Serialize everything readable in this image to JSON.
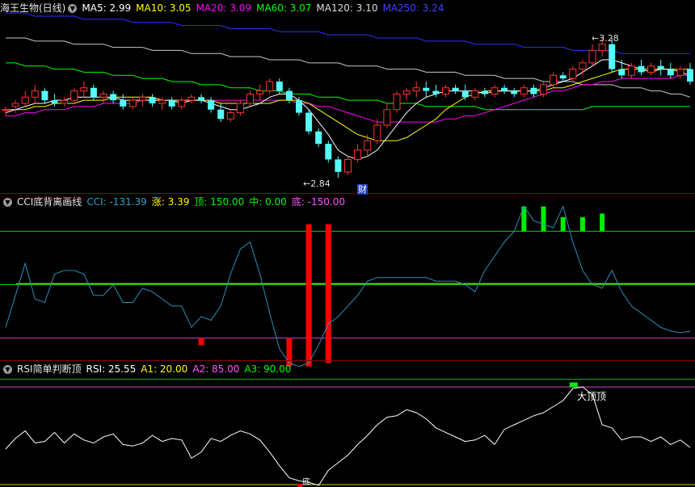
{
  "price_panel": {
    "title": "海王生物(日线)",
    "ma": [
      {
        "label": "MA5: 2.99",
        "color": "#ffffff"
      },
      {
        "label": "MA10: 3.05",
        "color": "#ffff00"
      },
      {
        "label": "MA20: 3.09",
        "color": "#ff00ff"
      },
      {
        "label": "MA60: 3.07",
        "color": "#00ff00"
      },
      {
        "label": "MA120: 3.10",
        "color": "#dddddd"
      },
      {
        "label": "MA250: 3.24",
        "color": "#4040ff"
      }
    ],
    "high_label": "3.28",
    "low_label": "2.84",
    "finance_mark": "财"
  },
  "cci_panel": {
    "title": "CCI底背离画线",
    "values": [
      {
        "label": "CCI: -131.39",
        "color": "#3aa0c8"
      },
      {
        "label": "涨: 3.39",
        "color": "#ffff00"
      },
      {
        "label": "顶: 150.00",
        "color": "#00ff00"
      },
      {
        "label": "中: 0.00",
        "color": "#00ff00"
      },
      {
        "label": "底: -150.00",
        "color": "#ff55ff"
      }
    ]
  },
  "rsi_panel": {
    "title": "RSI简单判断顶",
    "values": [
      {
        "label": "RSI: 25.55",
        "color": "#ffffff"
      },
      {
        "label": "A1: 20.00",
        "color": "#ffff00"
      },
      {
        "label": "A2: 85.00",
        "color": "#ff55ff"
      },
      {
        "label": "A3: 90.00",
        "color": "#00ff00"
      }
    ],
    "top_label": "大顶",
    "top_label2": "顶",
    "bottom_label": "底"
  },
  "colors": {
    "up": "#ff3232",
    "down": "#54fcfc",
    "separator": "#8b0000"
  },
  "chart_data": [
    {
      "type": "candlestick",
      "title": "海王生物(日线)",
      "ylim": [
        2.8,
        3.36
      ],
      "candles": [
        [
          3.06,
          3.07,
          3.04,
          3.06
        ],
        [
          3.07,
          3.09,
          3.05,
          3.08
        ],
        [
          3.08,
          3.12,
          3.07,
          3.1
        ],
        [
          3.1,
          3.14,
          3.08,
          3.12
        ],
        [
          3.12,
          3.13,
          3.08,
          3.09
        ],
        [
          3.09,
          3.11,
          3.07,
          3.08
        ],
        [
          3.08,
          3.1,
          3.07,
          3.09
        ],
        [
          3.09,
          3.13,
          3.08,
          3.12
        ],
        [
          3.12,
          3.15,
          3.1,
          3.13
        ],
        [
          3.13,
          3.14,
          3.09,
          3.1
        ],
        [
          3.1,
          3.12,
          3.08,
          3.11
        ],
        [
          3.11,
          3.12,
          3.08,
          3.09
        ],
        [
          3.09,
          3.11,
          3.06,
          3.07
        ],
        [
          3.07,
          3.1,
          3.06,
          3.09
        ],
        [
          3.09,
          3.11,
          3.07,
          3.1
        ],
        [
          3.1,
          3.11,
          3.07,
          3.08
        ],
        [
          3.08,
          3.1,
          3.06,
          3.09
        ],
        [
          3.09,
          3.1,
          3.06,
          3.07
        ],
        [
          3.07,
          3.1,
          3.06,
          3.09
        ],
        [
          3.09,
          3.11,
          3.08,
          3.1
        ],
        [
          3.1,
          3.11,
          3.08,
          3.09
        ],
        [
          3.09,
          3.1,
          3.05,
          3.06
        ],
        [
          3.06,
          3.08,
          3.02,
          3.03
        ],
        [
          3.03,
          3.06,
          3.02,
          3.05
        ],
        [
          3.05,
          3.09,
          3.04,
          3.08
        ],
        [
          3.08,
          3.12,
          3.07,
          3.11
        ],
        [
          3.11,
          3.14,
          3.09,
          3.12
        ],
        [
          3.12,
          3.16,
          3.11,
          3.15
        ],
        [
          3.15,
          3.16,
          3.11,
          3.12
        ],
        [
          3.12,
          3.13,
          3.08,
          3.09
        ],
        [
          3.09,
          3.1,
          3.04,
          3.05
        ],
        [
          3.05,
          3.06,
          2.98,
          2.99
        ],
        [
          2.99,
          3.0,
          2.94,
          2.95
        ],
        [
          2.95,
          2.96,
          2.89,
          2.9
        ],
        [
          2.9,
          2.91,
          2.84,
          2.86
        ],
        [
          2.86,
          2.91,
          2.85,
          2.9
        ],
        [
          2.9,
          2.95,
          2.89,
          2.93
        ],
        [
          2.93,
          2.98,
          2.91,
          2.96
        ],
        [
          2.96,
          3.03,
          2.95,
          3.01
        ],
        [
          3.01,
          3.08,
          3.0,
          3.06
        ],
        [
          3.06,
          3.12,
          3.05,
          3.11
        ],
        [
          3.11,
          3.13,
          3.09,
          3.12
        ],
        [
          3.12,
          3.15,
          3.1,
          3.13
        ],
        [
          3.13,
          3.15,
          3.1,
          3.12
        ],
        [
          3.12,
          3.14,
          3.1,
          3.11
        ],
        [
          3.11,
          3.14,
          3.1,
          3.13
        ],
        [
          3.13,
          3.14,
          3.11,
          3.12
        ],
        [
          3.12,
          3.14,
          3.09,
          3.1
        ],
        [
          3.1,
          3.13,
          3.09,
          3.12
        ],
        [
          3.12,
          3.13,
          3.1,
          3.11
        ],
        [
          3.11,
          3.14,
          3.1,
          3.13
        ],
        [
          3.13,
          3.14,
          3.11,
          3.12
        ],
        [
          3.12,
          3.13,
          3.1,
          3.11
        ],
        [
          3.11,
          3.14,
          3.1,
          3.13
        ],
        [
          3.13,
          3.14,
          3.1,
          3.11
        ],
        [
          3.11,
          3.15,
          3.1,
          3.14
        ],
        [
          3.14,
          3.18,
          3.13,
          3.17
        ],
        [
          3.17,
          3.18,
          3.15,
          3.16
        ],
        [
          3.16,
          3.2,
          3.15,
          3.19
        ],
        [
          3.19,
          3.22,
          3.17,
          3.21
        ],
        [
          3.21,
          3.27,
          3.2,
          3.25
        ],
        [
          3.25,
          3.29,
          3.23,
          3.27
        ],
        [
          3.27,
          3.29,
          3.18,
          3.19
        ],
        [
          3.19,
          3.22,
          3.16,
          3.17
        ],
        [
          3.17,
          3.21,
          3.16,
          3.2
        ],
        [
          3.2,
          3.22,
          3.17,
          3.18
        ],
        [
          3.18,
          3.21,
          3.17,
          3.2
        ],
        [
          3.2,
          3.22,
          3.17,
          3.19
        ],
        [
          3.19,
          3.21,
          3.16,
          3.17
        ],
        [
          3.17,
          3.2,
          3.16,
          3.19
        ],
        [
          3.19,
          3.21,
          3.14,
          3.15
        ]
      ],
      "ma_series": {
        "MA5": [
          3.05,
          3.06,
          3.07,
          3.08,
          3.08,
          3.09,
          3.09,
          3.1,
          3.1,
          3.1,
          3.1,
          3.1,
          3.09,
          3.09,
          3.09,
          3.09,
          3.09,
          3.09,
          3.08,
          3.09,
          3.09,
          3.08,
          3.07,
          3.06,
          3.06,
          3.07,
          3.08,
          3.1,
          3.11,
          3.11,
          3.09,
          3.06,
          3.02,
          2.98,
          2.93,
          2.91,
          2.9,
          2.91,
          2.93,
          2.97,
          3.01,
          3.05,
          3.08,
          3.1,
          3.11,
          3.12,
          3.12,
          3.12,
          3.12,
          3.11,
          3.12,
          3.12,
          3.12,
          3.12,
          3.12,
          3.13,
          3.14,
          3.15,
          3.16,
          3.18,
          3.2,
          3.22,
          3.22,
          3.21,
          3.2,
          3.19,
          3.18,
          3.19,
          3.19,
          3.18,
          3.17
        ],
        "MA10": [
          3.06,
          3.06,
          3.06,
          3.07,
          3.07,
          3.08,
          3.08,
          3.08,
          3.09,
          3.09,
          3.09,
          3.1,
          3.1,
          3.1,
          3.1,
          3.1,
          3.09,
          3.09,
          3.09,
          3.09,
          3.09,
          3.09,
          3.08,
          3.08,
          3.08,
          3.08,
          3.08,
          3.08,
          3.09,
          3.09,
          3.09,
          3.08,
          3.06,
          3.04,
          3.02,
          3.0,
          2.98,
          2.97,
          2.96,
          2.96,
          2.96,
          2.97,
          2.99,
          3.01,
          3.03,
          3.06,
          3.08,
          3.1,
          3.11,
          3.12,
          3.12,
          3.12,
          3.12,
          3.12,
          3.12,
          3.12,
          3.13,
          3.13,
          3.14,
          3.15,
          3.16,
          3.17,
          3.18,
          3.19,
          3.19,
          3.19,
          3.19,
          3.19,
          3.19,
          3.19,
          3.19
        ],
        "MA20": [
          3.04,
          3.04,
          3.05,
          3.05,
          3.06,
          3.06,
          3.06,
          3.07,
          3.07,
          3.07,
          3.08,
          3.08,
          3.08,
          3.08,
          3.09,
          3.09,
          3.09,
          3.09,
          3.09,
          3.09,
          3.09,
          3.09,
          3.09,
          3.09,
          3.09,
          3.09,
          3.09,
          3.09,
          3.09,
          3.09,
          3.08,
          3.08,
          3.07,
          3.07,
          3.06,
          3.05,
          3.04,
          3.03,
          3.02,
          3.02,
          3.02,
          3.02,
          3.02,
          3.02,
          3.02,
          3.03,
          3.03,
          3.04,
          3.04,
          3.05,
          3.06,
          3.07,
          3.08,
          3.09,
          3.1,
          3.11,
          3.12,
          3.12,
          3.13,
          3.14,
          3.14,
          3.15,
          3.15,
          3.16,
          3.16,
          3.16,
          3.16,
          3.16,
          3.16,
          3.17,
          3.17
        ],
        "MA60": [
          3.21,
          3.21,
          3.2,
          3.2,
          3.2,
          3.19,
          3.19,
          3.19,
          3.18,
          3.18,
          3.18,
          3.17,
          3.17,
          3.17,
          3.16,
          3.16,
          3.16,
          3.15,
          3.15,
          3.15,
          3.14,
          3.14,
          3.14,
          3.13,
          3.13,
          3.13,
          3.12,
          3.12,
          3.12,
          3.11,
          3.11,
          3.11,
          3.1,
          3.1,
          3.1,
          3.09,
          3.09,
          3.09,
          3.09,
          3.08,
          3.08,
          3.08,
          3.08,
          3.07,
          3.07,
          3.07,
          3.07,
          3.07,
          3.07,
          3.06,
          3.06,
          3.06,
          3.06,
          3.06,
          3.06,
          3.06,
          3.06,
          3.06,
          3.06,
          3.06,
          3.07,
          3.07,
          3.07,
          3.07,
          3.07,
          3.07,
          3.07,
          3.07,
          3.07,
          3.07,
          3.07
        ],
        "MA120": [
          3.29,
          3.29,
          3.29,
          3.28,
          3.28,
          3.28,
          3.28,
          3.27,
          3.27,
          3.27,
          3.27,
          3.26,
          3.26,
          3.26,
          3.26,
          3.25,
          3.25,
          3.25,
          3.25,
          3.24,
          3.24,
          3.24,
          3.24,
          3.23,
          3.23,
          3.23,
          3.23,
          3.22,
          3.22,
          3.22,
          3.22,
          3.21,
          3.21,
          3.21,
          3.21,
          3.2,
          3.2,
          3.2,
          3.2,
          3.19,
          3.19,
          3.19,
          3.19,
          3.18,
          3.18,
          3.18,
          3.18,
          3.17,
          3.17,
          3.17,
          3.17,
          3.16,
          3.16,
          3.16,
          3.16,
          3.15,
          3.15,
          3.15,
          3.15,
          3.14,
          3.14,
          3.14,
          3.14,
          3.13,
          3.13,
          3.13,
          3.12,
          3.12,
          3.11,
          3.11,
          3.1
        ],
        "MA250": [
          3.37,
          3.37,
          3.37,
          3.36,
          3.36,
          3.36,
          3.36,
          3.36,
          3.35,
          3.35,
          3.35,
          3.35,
          3.35,
          3.34,
          3.34,
          3.34,
          3.34,
          3.34,
          3.33,
          3.33,
          3.33,
          3.33,
          3.33,
          3.32,
          3.32,
          3.32,
          3.32,
          3.32,
          3.31,
          3.31,
          3.31,
          3.31,
          3.31,
          3.3,
          3.3,
          3.3,
          3.3,
          3.3,
          3.29,
          3.29,
          3.29,
          3.29,
          3.29,
          3.28,
          3.28,
          3.28,
          3.28,
          3.28,
          3.27,
          3.27,
          3.27,
          3.27,
          3.27,
          3.26,
          3.26,
          3.26,
          3.26,
          3.26,
          3.25,
          3.25,
          3.25,
          3.25,
          3.25,
          3.24,
          3.24,
          3.24,
          3.24,
          3.24,
          3.24,
          3.24,
          3.24
        ]
      }
    },
    {
      "type": "line",
      "title": "CCI底背离画线",
      "ylim": [
        -210,
        210
      ],
      "levels": {
        "top": 150,
        "middle": 0,
        "bottom": -150
      },
      "cci": [
        -120,
        -30,
        60,
        -40,
        -50,
        30,
        40,
        40,
        30,
        -30,
        -30,
        0,
        -50,
        -50,
        -10,
        -20,
        -40,
        -60,
        -60,
        -120,
        -90,
        -100,
        -60,
        30,
        100,
        120,
        30,
        -80,
        -180,
        -220,
        -230,
        -220,
        -170,
        -110,
        -90,
        -60,
        -30,
        10,
        20,
        20,
        20,
        20,
        20,
        20,
        10,
        10,
        10,
        0,
        -20,
        40,
        80,
        120,
        150,
        220,
        180,
        170,
        160,
        220,
        120,
        40,
        0,
        -10,
        40,
        -20,
        -60,
        -80,
        -100,
        -120,
        -130,
        -135,
        -131
      ],
      "red_bars": [
        [
          20,
          -150,
          -170
        ],
        [
          29,
          -150,
          -230
        ],
        [
          31,
          -230,
          170
        ],
        [
          33,
          -220,
          170
        ]
      ],
      "green_bars": [
        [
          53,
          150,
          220
        ],
        [
          55,
          150,
          220
        ],
        [
          57,
          150,
          190
        ],
        [
          59,
          150,
          190
        ],
        [
          61,
          150,
          200
        ]
      ]
    },
    {
      "type": "line",
      "title": "RSI简单判断顶",
      "ylim": [
        20,
        92
      ],
      "levels": {
        "A1": 20,
        "A2": 85,
        "A3": 90
      },
      "rsi": [
        44,
        51,
        56,
        48,
        49,
        55,
        48,
        54,
        50,
        48,
        52,
        54,
        47,
        46,
        48,
        53,
        49,
        51,
        50,
        38,
        42,
        51,
        49,
        53,
        56,
        54,
        50,
        42,
        33,
        25,
        23,
        22,
        20,
        30,
        35,
        40,
        47,
        53,
        60,
        65,
        66,
        70,
        68,
        64,
        58,
        55,
        52,
        49,
        50,
        53,
        47,
        57,
        60,
        63,
        66,
        68,
        72,
        76,
        84,
        85,
        80,
        60,
        58,
        50,
        52,
        52,
        49,
        52,
        47,
        50,
        45
      ]
    }
  ]
}
